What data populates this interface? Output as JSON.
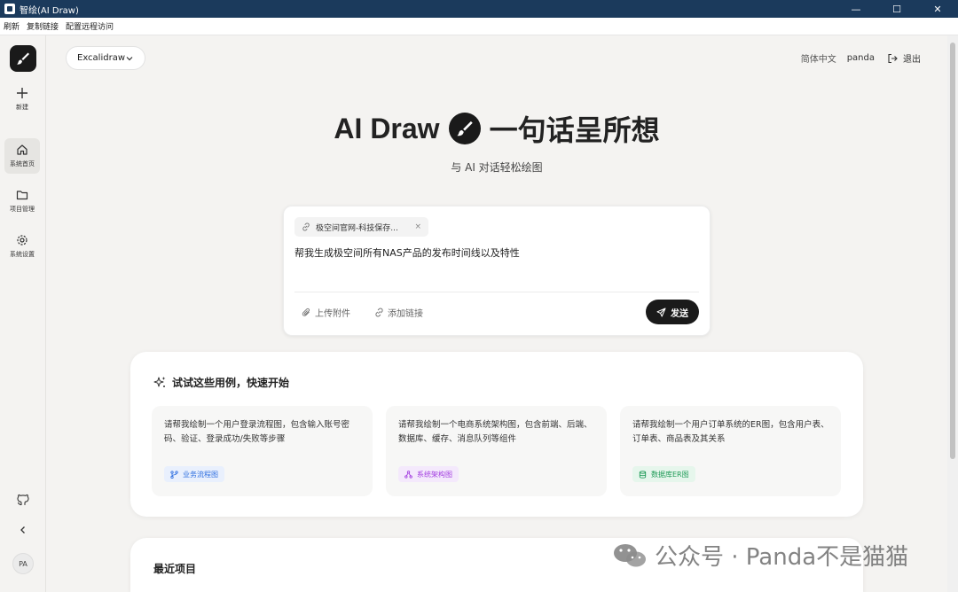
{
  "window": {
    "title": "智绘(AI Draw)",
    "minimize": "—",
    "maximize": "☐",
    "close": "✕"
  },
  "menu": [
    "刷新",
    "复制链接",
    "配置远程访问"
  ],
  "sidebar": {
    "items": [
      {
        "label": "新建",
        "icon": "plus-icon"
      },
      {
        "label": "系统首页",
        "icon": "home-icon"
      },
      {
        "label": "项目管理",
        "icon": "folder-icon"
      },
      {
        "label": "系统设置",
        "icon": "gear-icon"
      }
    ],
    "avatar": "PA"
  },
  "header": {
    "engine": "Excalidraw",
    "language": "简体中文",
    "user": "panda",
    "logout": "退出"
  },
  "hero": {
    "title_left": "AI Draw",
    "title_right": "一句话呈所想",
    "subtitle": "与 AI 对话轻松绘图"
  },
  "composer": {
    "attachment": "极空间官网-科技保存...",
    "prompt": "帮我生成极空间所有NAS产品的发布时间线以及特性",
    "upload_label": "上传附件",
    "link_label": "添加链接",
    "send_label": "发送"
  },
  "examples": {
    "heading": "试试这些用例，快速开始",
    "cards": [
      {
        "text": "请帮我绘制一个用户登录流程图，包含输入账号密码、验证、登录成功/失败等步骤",
        "tag": "业务流程图",
        "color": "#2f6fe0"
      },
      {
        "text": "请帮我绘制一个电商系统架构图，包含前端、后端、数据库、缓存、消息队列等组件",
        "tag": "系统架构图",
        "color": "#a33ee0"
      },
      {
        "text": "请帮我绘制一个用户订单系统的ER图，包含用户表、订单表、商品表及其关系",
        "tag": "数据库ER图",
        "color": "#1f9a57"
      }
    ]
  },
  "recent": {
    "heading": "最近项目"
  },
  "watermark": "公众号 · Panda不是猫猫"
}
